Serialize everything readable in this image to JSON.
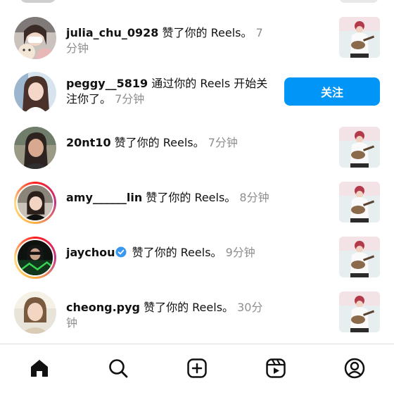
{
  "colors": {
    "accent": "#0095f6",
    "verified": "#3897f0",
    "time": "#8e8e8e"
  },
  "notifications": [
    {
      "username": "julia_chu_0928",
      "action": " 赞了你的 Reels。",
      "time": "7分钟",
      "kind": "like"
    },
    {
      "username": "peggy__5819",
      "action": " 通过你的 Reels 开始关注你了。",
      "time": "7分钟",
      "kind": "follow",
      "button": "关注"
    },
    {
      "username": "20nt10",
      "action": " 赞了你的 Reels。",
      "time": "7分钟",
      "kind": "like"
    },
    {
      "username": "amy______lin",
      "action": " 赞了你的 Reels。",
      "time": "8分钟",
      "kind": "like"
    },
    {
      "username": "jaychou",
      "action": " 赞了你的 Reels。",
      "time": "9分钟",
      "kind": "like",
      "verified": true
    },
    {
      "username": "cheong.pyg",
      "action": " 赞了你的 Reels。",
      "time": "30分钟",
      "kind": "like"
    }
  ],
  "tabbar": {
    "tabs": [
      {
        "icon": "home-icon",
        "active": true
      },
      {
        "icon": "search-icon",
        "active": false
      },
      {
        "icon": "create-icon",
        "active": false
      },
      {
        "icon": "reels-icon",
        "active": false
      },
      {
        "icon": "profile-icon",
        "active": false
      }
    ]
  }
}
